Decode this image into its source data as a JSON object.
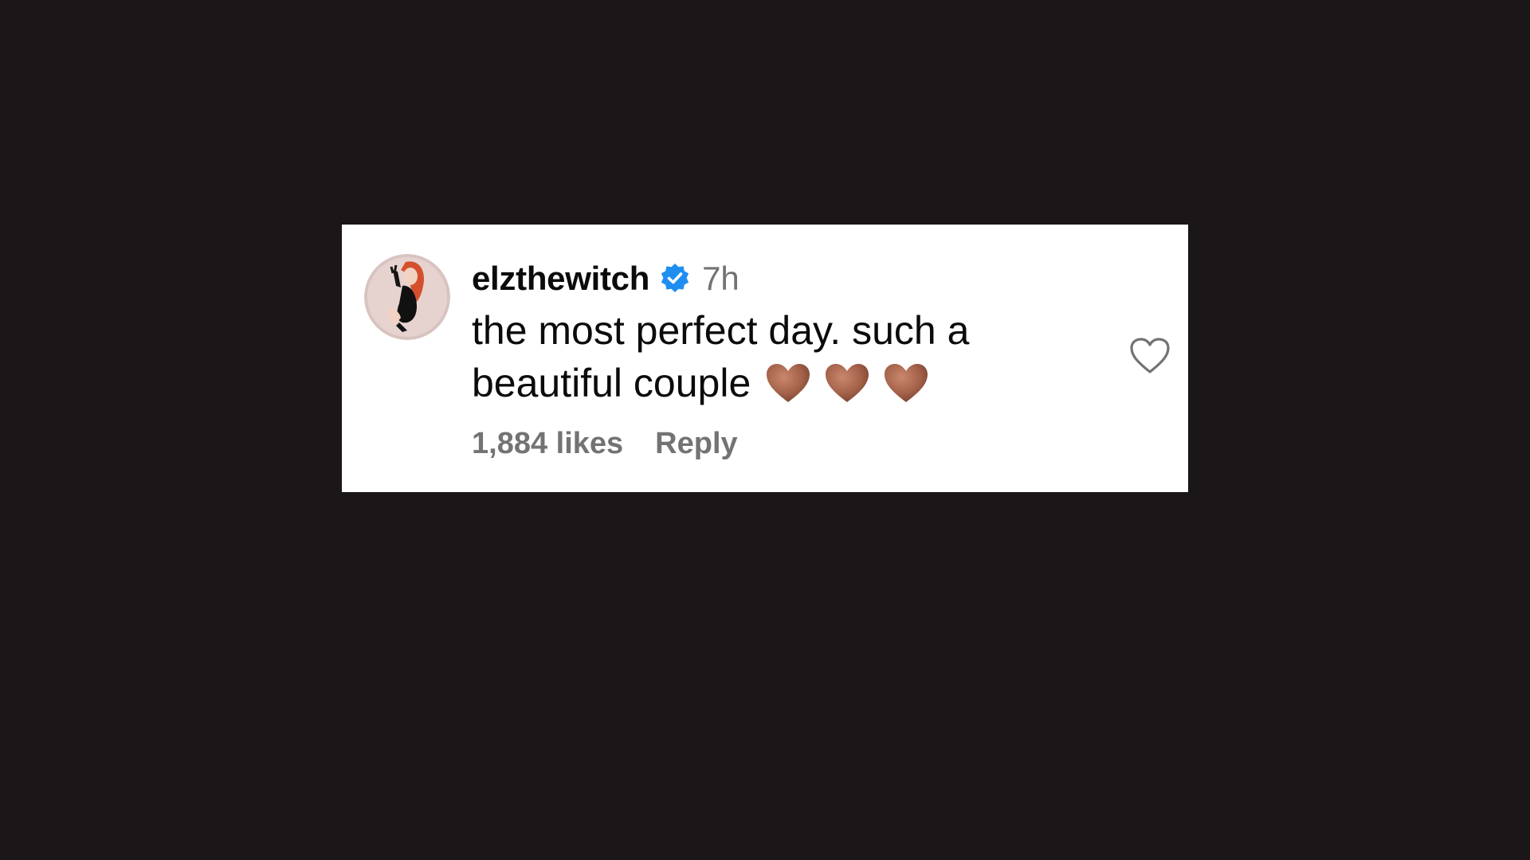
{
  "comment": {
    "username": "elzthewitch",
    "verified_icon": "verified-badge-icon",
    "time": "7h",
    "text": "the most perfect day. such a beautiful couple",
    "emojis": [
      "brown-heart-emoji",
      "brown-heart-emoji",
      "brown-heart-emoji"
    ],
    "likes": "1,884 likes",
    "reply_label": "Reply",
    "like_icon": "heart-outline-icon"
  },
  "colors": {
    "background": "#1b1617",
    "card": "#ffffff",
    "verified": "#1f8ef1",
    "secondary_text": "#737373",
    "heart_emoji": "#a4624a"
  }
}
